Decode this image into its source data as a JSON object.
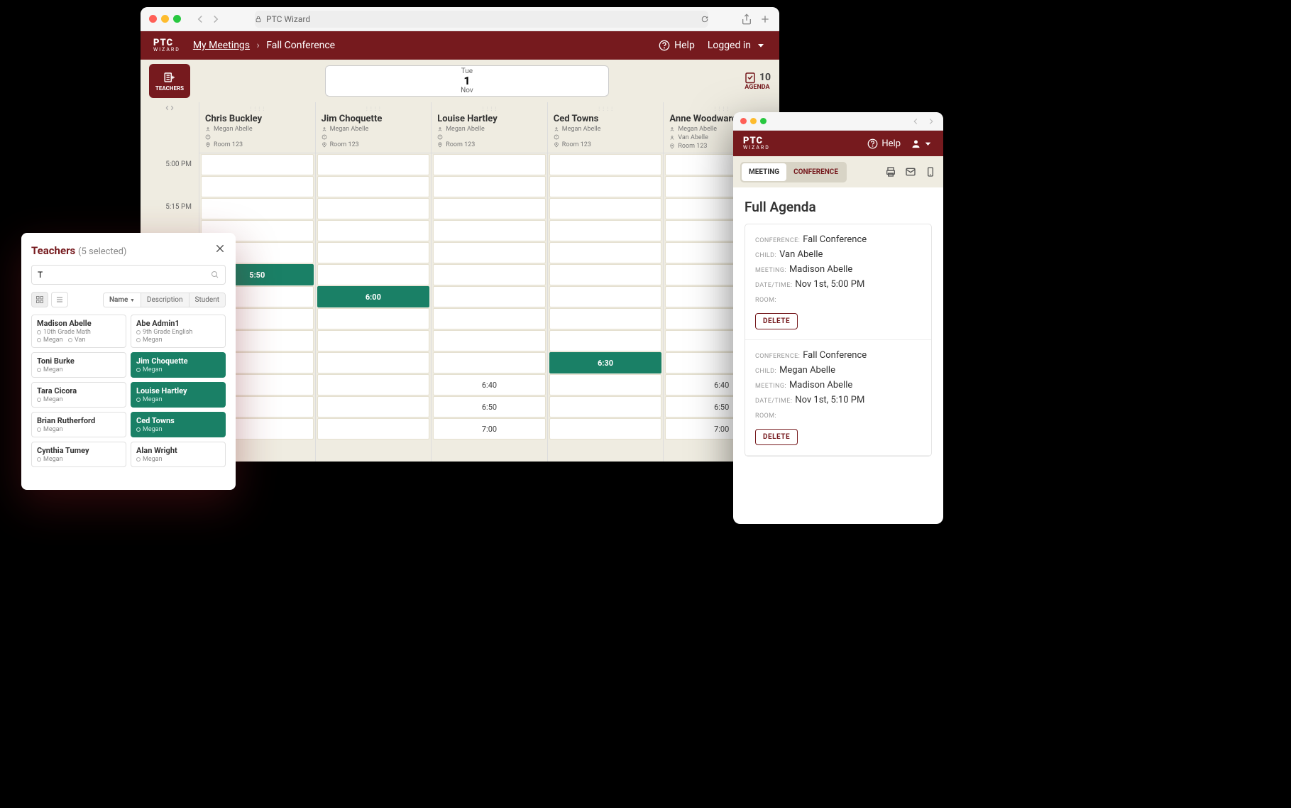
{
  "browser": {
    "title": "PTC Wizard"
  },
  "header": {
    "logo": "PTC",
    "logo_sub": "WIZARD",
    "crumb_my_meetings": "My Meetings",
    "crumb_current": "Fall Conference",
    "help": "Help",
    "logged_in": "Logged in"
  },
  "toolbar": {
    "teachers_label": "TEACHERS",
    "date": {
      "dow": "Tue",
      "day": "1",
      "month": "Nov"
    },
    "agenda": {
      "count": "10",
      "label": "AGENDA"
    }
  },
  "teachers_columns": [
    {
      "name": "Chris Buckley",
      "student": "Megan Abelle",
      "room": "Room 123"
    },
    {
      "name": "Jim Choquette",
      "student": "Megan Abelle",
      "room": "Room 123"
    },
    {
      "name": "Louise Hartley",
      "student": "Megan Abelle",
      "room": "Room 123"
    },
    {
      "name": "Ced Towns",
      "student": "Megan Abelle",
      "room": "Room 123"
    },
    {
      "name": "Anne Woodward",
      "student": "Megan Abelle",
      "student2": "Van Abelle",
      "room": "Room 123"
    }
  ],
  "times": [
    "5:00 PM",
    "",
    "5:15 PM",
    "",
    "",
    "",
    "",
    "",
    "",
    "",
    "",
    "",
    ""
  ],
  "slots": {
    "chris": [
      "",
      "",
      "",
      "",
      "",
      "5:50",
      "",
      "",
      "",
      "",
      "",
      "",
      ""
    ],
    "jim": [
      "",
      "",
      "",
      "",
      "",
      "",
      "6:00",
      "",
      "",
      "",
      "",
      "",
      ""
    ],
    "louise": [
      "",
      "",
      "",
      "",
      "",
      "",
      "",
      "",
      "",
      "",
      "6:40",
      "6:50",
      "7:00"
    ],
    "ced": [
      "",
      "",
      "",
      "",
      "",
      "",
      "",
      "",
      "",
      "6:30",
      "",
      "",
      ""
    ],
    "anne": [
      "",
      "",
      "",
      "",
      "",
      "",
      "",
      "",
      "",
      "",
      "6:40",
      "6:50",
      "7:00"
    ]
  },
  "slot_filled": {
    "chris": [
      0,
      0,
      0,
      0,
      0,
      1,
      0,
      0,
      0,
      0,
      0,
      0,
      0
    ],
    "jim": [
      0,
      0,
      0,
      0,
      0,
      0,
      1,
      0,
      0,
      0,
      0,
      0,
      0
    ],
    "louise": [
      0,
      0,
      0,
      0,
      0,
      0,
      0,
      0,
      0,
      0,
      0,
      0,
      0
    ],
    "ced": [
      0,
      0,
      0,
      0,
      0,
      0,
      0,
      0,
      0,
      1,
      0,
      0,
      0
    ],
    "anne": [
      0,
      0,
      0,
      0,
      0,
      0,
      0,
      0,
      0,
      0,
      0,
      0,
      0
    ]
  },
  "popup": {
    "title": "Teachers",
    "count": "(5 selected)",
    "search_value": "T",
    "sort": {
      "name": "Name",
      "desc": "Description",
      "student": "Student"
    },
    "cards": [
      {
        "name": "Madison Abelle",
        "line1": "10th Grade Math",
        "line2a": "Megan",
        "line2b": "Van",
        "sel": false
      },
      {
        "name": "Abe Admin1",
        "line1": "9th Grade English",
        "line2a": "Megan",
        "sel": false
      },
      {
        "name": "Toni Burke",
        "line2a": "Megan",
        "sel": false
      },
      {
        "name": "Jim Choquette",
        "line2a": "Megan",
        "sel": true
      },
      {
        "name": "Tara Cicora",
        "line2a": "Megan",
        "sel": false
      },
      {
        "name": "Louise Hartley",
        "line2a": "Megan",
        "sel": true
      },
      {
        "name": "Brian Rutherford",
        "line2a": "Megan",
        "sel": false
      },
      {
        "name": "Ced Towns",
        "line2a": "Megan",
        "sel": true
      },
      {
        "name": "Cynthia Tumey",
        "line2a": "Megan",
        "sel": false
      },
      {
        "name": "Alan Wright",
        "line2a": "Megan",
        "sel": false
      }
    ]
  },
  "mobile": {
    "help": "Help",
    "tabs": {
      "meeting": "MEETING",
      "conference": "CONFERENCE"
    },
    "title": "Full Agenda",
    "labels": {
      "conference": "CONFERENCE:",
      "child": "CHILD:",
      "meeting": "MEETING:",
      "dt": "DATE/TIME:",
      "room": "ROOM:",
      "delete": "DELETE"
    },
    "items": [
      {
        "conference": "Fall Conference",
        "child": "Van Abelle",
        "meeting": "Madison Abelle",
        "dt": "Nov 1st, 5:00 PM",
        "room": ""
      },
      {
        "conference": "Fall Conference",
        "child": "Megan Abelle",
        "meeting": "Madison Abelle",
        "dt": "Nov 1st, 5:10 PM",
        "room": ""
      }
    ]
  }
}
